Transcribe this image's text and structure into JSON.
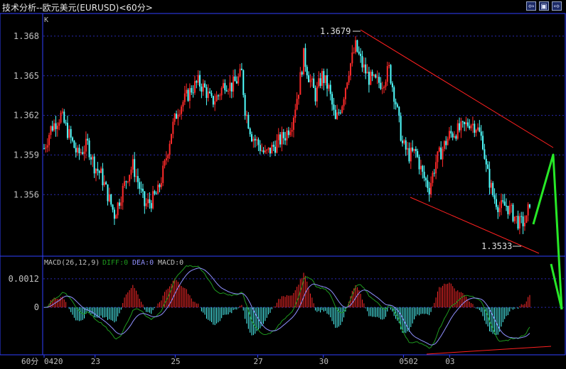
{
  "window": {
    "title": "技术分析--欧元美元(EURUSD)<60分>",
    "buttons": [
      {
        "name": "prev-window-button",
        "icon": "arrow-left-icon"
      },
      {
        "name": "restore-window-button",
        "icon": "split-window-icon"
      },
      {
        "name": "next-window-button",
        "icon": "arrow-right-icon"
      }
    ]
  },
  "colors": {
    "up": "#ff2a2a",
    "down": "#50ffff",
    "panel_border": "#3040ff",
    "grid": "#2a2ab0",
    "axis_text": "#c0c0c0",
    "diff_line": "#1e9a1e",
    "dea_line": "#9090ff",
    "trendline": "#ff2020",
    "annotation": "#27e827"
  },
  "chart_data": [
    {
      "type": "candlestick",
      "panel_label": "K",
      "y_ticks": [
        "1.368",
        "1.365",
        "1.362",
        "1.359",
        "1.356"
      ],
      "ylim": [
        1.3515,
        1.3695
      ],
      "x_ticks": [
        "0420",
        "23",
        "25",
        "27",
        "30",
        "0502",
        "03"
      ],
      "period_label": "60分",
      "annotations": {
        "high_label": "1.3679",
        "low_label": "1.3533"
      },
      "close_path": [
        [
          0,
          1.3595
        ],
        [
          4,
          1.361
        ],
        [
          10,
          1.362
        ],
        [
          15,
          1.3605
        ],
        [
          20,
          1.359
        ],
        [
          26,
          1.3598
        ],
        [
          30,
          1.3582
        ],
        [
          34,
          1.3575
        ],
        [
          38,
          1.356
        ],
        [
          42,
          1.3545
        ],
        [
          46,
          1.356
        ],
        [
          50,
          1.3575
        ],
        [
          53,
          1.3582
        ],
        [
          56,
          1.357
        ],
        [
          60,
          1.3552
        ],
        [
          64,
          1.3555
        ],
        [
          68,
          1.3562
        ],
        [
          72,
          1.3582
        ],
        [
          76,
          1.3608
        ],
        [
          80,
          1.3625
        ],
        [
          84,
          1.3632
        ],
        [
          88,
          1.364
        ],
        [
          92,
          1.3645
        ],
        [
          96,
          1.364
        ],
        [
          100,
          1.363
        ],
        [
          104,
          1.3635
        ],
        [
          108,
          1.3645
        ],
        [
          112,
          1.3642
        ],
        [
          116,
          1.3648
        ],
        [
          118,
          1.3652
        ],
        [
          120,
          1.3625
        ],
        [
          124,
          1.3605
        ],
        [
          128,
          1.3598
        ],
        [
          132,
          1.359
        ],
        [
          136,
          1.3595
        ],
        [
          140,
          1.36
        ],
        [
          144,
          1.3605
        ],
        [
          148,
          1.3615
        ],
        [
          152,
          1.364
        ],
        [
          155,
          1.3665
        ],
        [
          158,
          1.365
        ],
        [
          162,
          1.3635
        ],
        [
          166,
          1.365
        ],
        [
          170,
          1.364
        ],
        [
          174,
          1.3615
        ],
        [
          178,
          1.363
        ],
        [
          182,
          1.3655
        ],
        [
          186,
          1.3672
        ],
        [
          190,
          1.3658
        ],
        [
          194,
          1.3648
        ],
        [
          198,
          1.3645
        ],
        [
          202,
          1.3645
        ],
        [
          206,
          1.3655
        ],
        [
          210,
          1.363
        ],
        [
          214,
          1.3598
        ],
        [
          218,
          1.359
        ],
        [
          222,
          1.3592
        ],
        [
          226,
          1.3575
        ],
        [
          230,
          1.3565
        ],
        [
          234,
          1.3585
        ],
        [
          238,
          1.3595
        ],
        [
          242,
          1.3605
        ],
        [
          246,
          1.3608
        ],
        [
          250,
          1.361
        ],
        [
          254,
          1.3615
        ],
        [
          258,
          1.3612
        ],
        [
          262,
          1.36
        ],
        [
          264,
          1.358
        ],
        [
          268,
          1.356
        ],
        [
          272,
          1.355
        ],
        [
          276,
          1.3552
        ],
        [
          280,
          1.3545
        ],
        [
          284,
          1.3538
        ],
        [
          288,
          1.354
        ],
        [
          290,
          1.3555
        ]
      ]
    },
    {
      "type": "bar",
      "title": "MACD(26,12,9)",
      "legend": [
        {
          "name": "DIFF",
          "value_label": "DIFF:0"
        },
        {
          "name": "DEA",
          "value_label": "DEA:0"
        },
        {
          "name": "MACD",
          "value_label": "MACD:0"
        }
      ],
      "y_ticks": [
        "0.0012",
        "0"
      ],
      "ylim": [
        -0.0019,
        0.002
      ]
    }
  ]
}
